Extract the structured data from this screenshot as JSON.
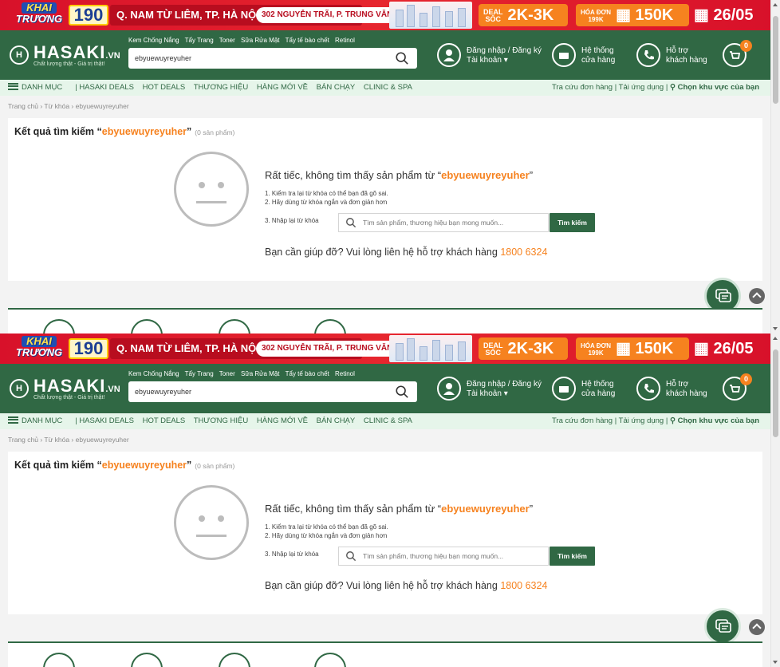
{
  "promo": {
    "khai": "KHAI",
    "truong": "TRƯƠNG",
    "number": "190",
    "address": "Q. NAM TỪ LIÊM, TP. HÀ NỘI",
    "address_pill": "302 NGUYỄN TRÃI, P. TRUNG VĂN",
    "deal_small_1": "DEAL",
    "deal_small_2": "SỐC",
    "deal_value": "2K-3K",
    "bill_small_1": "HÓA ĐƠN",
    "bill_small_2": "199K",
    "bill_value": "150K",
    "date": "26/05"
  },
  "header": {
    "logo": "HASAKI",
    "logo_suffix": ".VN",
    "logo_tagline": "Chất lượng thật - Giá trị thật!",
    "quick_links": [
      "Kem Chống Nắng",
      "Tẩy Trang",
      "Toner",
      "Sữa Rửa Mặt",
      "Tẩy tế bào chết",
      "Retinol"
    ],
    "search_value": "ebyuewuyreyuher",
    "account_line1": "Đăng nhập / Đăng ký",
    "account_line2": "Tài khoản",
    "store_line1": "Hệ thống",
    "store_line2": "cửa hàng",
    "support_line1": "Hỗ trợ",
    "support_line2": "khách hàng",
    "cart_count": "0"
  },
  "nav": {
    "menu": "DANH MỤC",
    "items": [
      "HASAKI DEALS",
      "HOT DEALS",
      "THƯƠNG HIỆU",
      "HÀNG MỚI VỀ",
      "BÁN CHẠY",
      "CLINIC & SPA"
    ],
    "right_1": "Tra cứu đơn hàng",
    "right_2": "Tải ứng dụng",
    "right_3": "Chọn khu vực của bạn"
  },
  "breadcrumb": {
    "home": "Trang chủ",
    "keyword": "Từ khóa",
    "current": "ebyuewuyreyuher"
  },
  "results": {
    "title_prefix": "Kết quả tìm kiếm “",
    "keyword": "ebyuewuyreyuher",
    "title_suffix": "”",
    "count": "(0 sản phẩm)",
    "sorry_prefix": "Rất tiếc, không tìm thấy sản phẩm từ “",
    "sorry_suffix": "”",
    "tip_1": "1. Kiểm tra lại từ khóa có thể bạn đã gõ sai.",
    "tip_2": "2. Hãy dùng từ khóa ngắn và đơn giản hơn",
    "retry_label": "3. Nhập lại từ khóa",
    "retry_placeholder": "Tìm sản phẩm, thương hiệu bạn mong muốn...",
    "retry_button": "Tìm kiếm",
    "help_text": "Bạn cần giúp đỡ? Vui lòng liên hệ hỗ trợ khách hàng",
    "phone": "1800 6324"
  },
  "colors": {
    "brand_green": "#306844",
    "accent_orange": "#f6821f",
    "promo_red": "#d8112a"
  }
}
